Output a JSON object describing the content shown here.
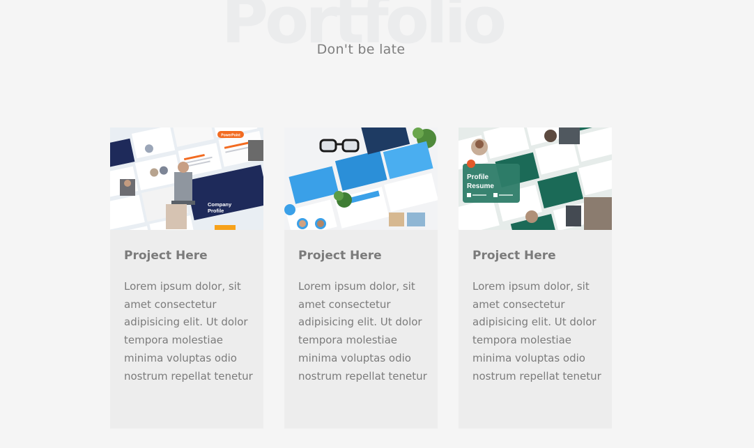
{
  "header": {
    "background_title": "Portfolio",
    "subtitle": "Don't be late"
  },
  "cards": [
    {
      "title": "Project Here",
      "text": "Lorem ipsum dolor, sit amet consectetur adipisicing elit. Ut dolor tempora molestiae minima voluptas odio nostrum repellat tenetur",
      "thumbnail": {
        "label_line1": "Company",
        "label_line2": "Profile",
        "badge": "PowerPoint",
        "accent": "#1e2a5a",
        "badge_color": "#f26b21"
      }
    },
    {
      "title": "Project Here",
      "text": "Lorem ipsum dolor, sit amet consectetur adipisicing elit. Ut dolor tempora molestiae minima voluptas odio nostrum repellat tenetur",
      "thumbnail": {
        "accent": "#3aa0e8"
      }
    },
    {
      "title": "Project Here",
      "text": "Lorem ipsum dolor, sit amet consectetur adipisicing elit. Ut dolor tempora molestiae minima voluptas odio nostrum repellat tenetur",
      "thumbnail": {
        "label_line1": "Profile",
        "label_line2": "Resume",
        "accent": "#1b6a57"
      }
    }
  ],
  "colors": {
    "page_bg": "#f5f5f5",
    "card_bg": "#ededed",
    "text": "#7b7b7b"
  }
}
